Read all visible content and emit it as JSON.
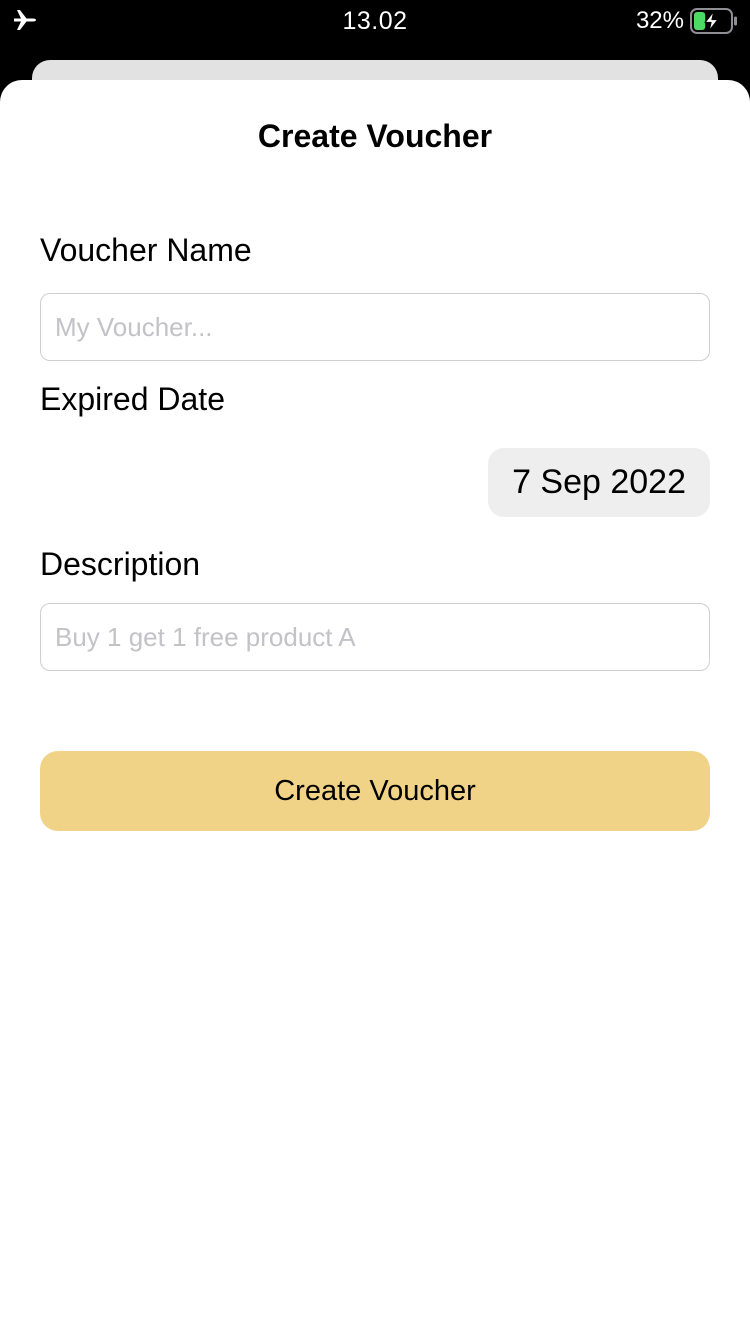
{
  "status_bar": {
    "left_icon": "airplane-icon",
    "time": "13.02",
    "battery_percent": "32%",
    "battery_icon": "battery-charging-icon",
    "battery_level": 0.32,
    "battery_color": "#4cd964"
  },
  "sheet": {
    "title": "Create Voucher"
  },
  "form": {
    "voucher_name": {
      "label": "Voucher Name",
      "value": "",
      "placeholder": "My Voucher..."
    },
    "expired_date": {
      "label": "Expired Date",
      "value": "7 Sep 2022"
    },
    "description": {
      "label": "Description",
      "value": "",
      "placeholder": "Buy 1 get 1 free product A"
    },
    "submit_label": "Create Voucher",
    "accent_color": "#f1d387"
  }
}
